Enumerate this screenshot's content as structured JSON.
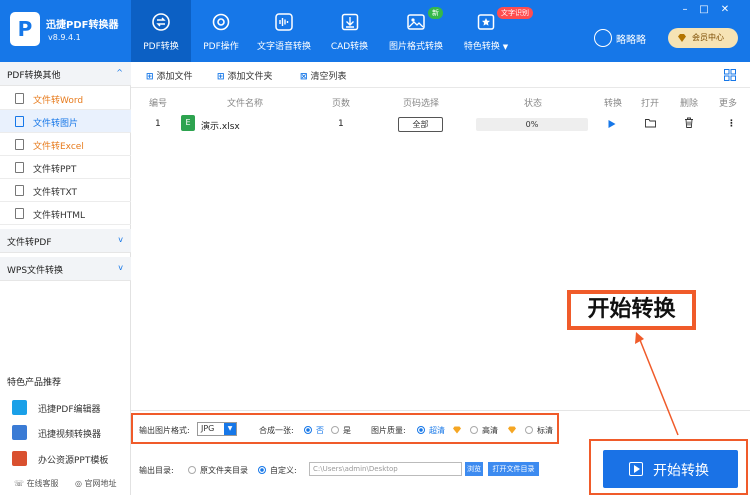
{
  "app": {
    "name": "迅捷PDF转换器",
    "version": "v8.9.4.1"
  },
  "nav": [
    {
      "label": "PDF转换",
      "icon": "convert-icon",
      "active": true
    },
    {
      "label": "PDF操作",
      "icon": "gear-icon"
    },
    {
      "label": "文字语音转换",
      "icon": "audio-wave-icon"
    },
    {
      "label": "CAD转换",
      "icon": "download-box-icon"
    },
    {
      "label": "图片格式转换",
      "icon": "image-icon",
      "badge": "新"
    },
    {
      "label": "特色转换",
      "icon": "star-box-icon",
      "badge": "文字识别"
    }
  ],
  "user": {
    "name": "略略略",
    "member": "会员中心"
  },
  "window": {
    "minimize": "–",
    "maximize": "□",
    "close": "✕"
  },
  "sidebar": {
    "sections": [
      {
        "label": "PDF转换其他",
        "chevron": "^"
      },
      {
        "label": "文件转PDF",
        "chevron": "v"
      },
      {
        "label": "WPS文件转换",
        "chevron": "v"
      }
    ],
    "items": [
      {
        "label": "文件转Word"
      },
      {
        "label": "文件转图片"
      },
      {
        "label": "文件转Excel"
      },
      {
        "label": "文件转PPT"
      },
      {
        "label": "文件转TXT"
      },
      {
        "label": "文件转HTML"
      }
    ],
    "recommend_title": "特色产品推荐",
    "recommend": [
      {
        "label": "迅捷PDF编辑器"
      },
      {
        "label": "迅捷视频转换器"
      },
      {
        "label": "办公资源PPT模板"
      }
    ],
    "footer": {
      "service": "在线客服",
      "site": "官网地址"
    }
  },
  "toolbar": {
    "add_file": "添加文件",
    "add_folder": "添加文件夹",
    "clear": "清空列表"
  },
  "table": {
    "headers": [
      "编号",
      "文件名称",
      "页数",
      "页码选择",
      "状态",
      "转换",
      "打开",
      "删除",
      "更多"
    ],
    "rows": [
      {
        "no": "1",
        "name": "演示.xlsx",
        "pages": "1",
        "range": "全部",
        "status": "0%",
        "file_icon": "E"
      }
    ]
  },
  "options": {
    "format_label": "输出图片格式:",
    "format_value": "JPG",
    "merge_label": "合成一张:",
    "merge_no": "否",
    "merge_yes": "是",
    "quality_label": "图片质量:",
    "quality": [
      "超清",
      "高清",
      "标清"
    ],
    "output_label": "输出目录:",
    "output_original": "原文件夹目录",
    "output_custom": "自定义:",
    "path": "C:\\Users\\admin\\Desktop",
    "browse": "浏览",
    "open_dir": "打开文件目录"
  },
  "start_button": "开始转换",
  "callout": "开始转换",
  "colors": {
    "primary": "#1677e8",
    "highlight": "#f05b2a",
    "excel": "#2da34f",
    "gold": "#f6e3b4"
  }
}
